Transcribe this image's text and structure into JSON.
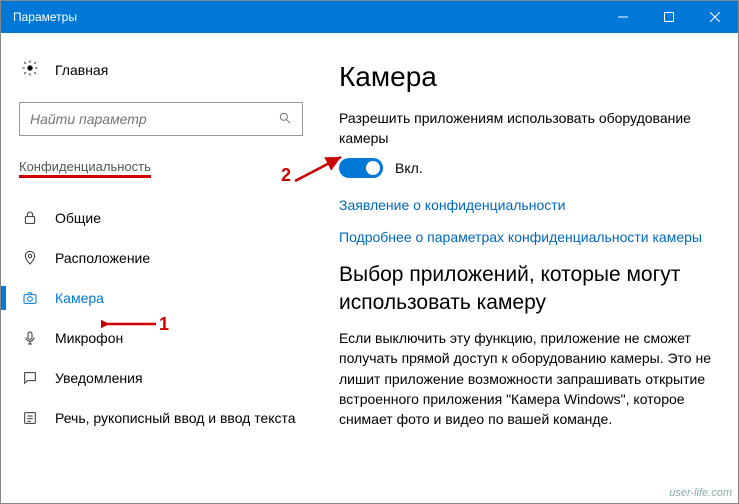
{
  "window": {
    "title": "Параметры"
  },
  "sidebar": {
    "home": "Главная",
    "search_placeholder": "Найти параметр",
    "section": "Конфиденциальность",
    "items": [
      {
        "label": "Общие"
      },
      {
        "label": "Расположение"
      },
      {
        "label": "Камера"
      },
      {
        "label": "Микрофон"
      },
      {
        "label": "Уведомления"
      },
      {
        "label": "Речь, рукописный ввод и ввод текста"
      }
    ]
  },
  "main": {
    "title": "Камера",
    "allow_desc": "Разрешить приложениям использовать оборудование камеры",
    "toggle_state": "Вкл.",
    "link_privacy": "Заявление о конфиденциальности",
    "link_more": "Подробнее о параметрах конфиденциальности камеры",
    "section2_title": "Выбор приложений, которые могут использовать камеру",
    "section2_body": "Если выключить эту функцию, приложение не сможет получать прямой доступ к оборудованию камеры. Это не лишит приложение возможности запрашивать открытие встроенного приложения \"Камера Windows\", которое снимает фото и видео по вашей команде."
  },
  "annotations": {
    "one": "1",
    "two": "2"
  },
  "watermark": "user-life.com"
}
